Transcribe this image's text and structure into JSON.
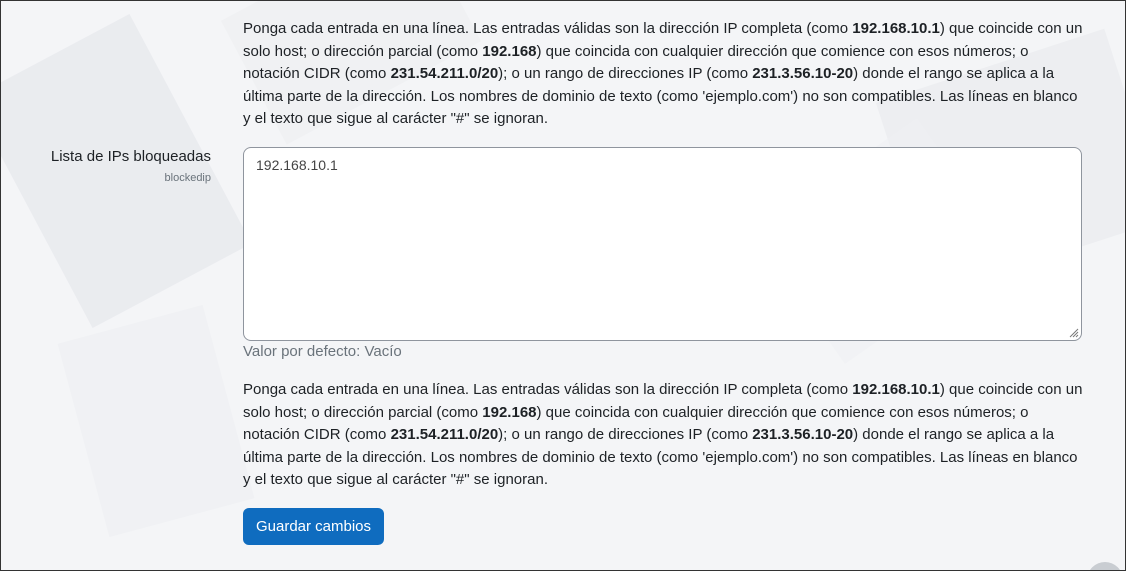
{
  "help_text": {
    "p1": "Ponga cada entrada en una línea. Las entradas válidas son la dirección IP completa (como ",
    "b1": "192.168.10.1",
    "p2": ") que coincide con un solo host; o dirección parcial (como ",
    "b2": "192.168",
    "p3": ") que coincida con cualquier dirección que comience con esos números; o notación CIDR (como ",
    "b3": "231.54.211.0/20",
    "p4": "); o un rango de direcciones IP (como ",
    "b4": "231.3.56.10-20",
    "p5": ") donde el rango se aplica a la última parte de la dirección. Los nombres de dominio de texto (como 'ejemplo.com') no son compatibles. Las líneas en blanco y el texto que sigue al carácter \"#\" se ignoran."
  },
  "field": {
    "label": "Lista de IPs bloqueadas",
    "setting_name": "blockedip",
    "value": "192.168.10.1",
    "default_text": "Valor por defecto: Vacío"
  },
  "save_button": {
    "label": "Guardar cambios",
    "color": "#0f6cbf"
  }
}
